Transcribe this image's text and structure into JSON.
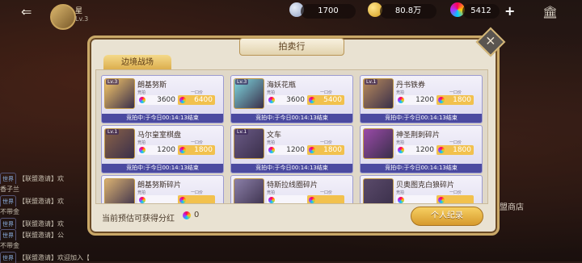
{
  "top": {
    "player_name": "星",
    "player_level": "Lv.3",
    "crystals": "1700",
    "gold": "80.8万",
    "gems": "5412",
    "plus": "+"
  },
  "chat": [
    {
      "tag": "世界",
      "text": "【联盟邀请】欢"
    },
    {
      "tag": "",
      "text": "香子兰"
    },
    {
      "tag": "世界",
      "text": "【联盟邀请】欢"
    },
    {
      "tag": "",
      "text": "不带金"
    },
    {
      "tag": "世界",
      "text": "【联盟邀请】欢"
    },
    {
      "tag": "世界",
      "text": "【联盟邀请】公"
    },
    {
      "tag": "",
      "text": "不带金"
    },
    {
      "tag": "世界",
      "text": "【联盟邀请】欢迎加入【恶的家】"
    }
  ],
  "alliance_shop": "盟商店",
  "modal": {
    "title": "拍卖行",
    "tab": "边境战场",
    "bid_label": "竞拍",
    "buyout_label": "一口价",
    "items": [
      {
        "name": "朗基努斯",
        "lv": "Lv.3",
        "bid": "3600",
        "buyout": "6400",
        "timer": "竞拍中:于今日00:14:13结束",
        "color": "#f7c86a"
      },
      {
        "name": "海妖花瓶",
        "lv": "Lv.3",
        "bid": "3600",
        "buyout": "5400",
        "timer": "竞拍中:于今日00:14:13结束",
        "color": "#7fd8e0"
      },
      {
        "name": "丹书铁券",
        "lv": "Lv.1",
        "bid": "1200",
        "buyout": "1800",
        "timer": "竞拍中:于今日00:14:13结束",
        "color": "#b88a5c"
      },
      {
        "name": "马尔皇室棋盘",
        "lv": "Lv.1",
        "bid": "1200",
        "buyout": "1800",
        "timer": "竞拍中:于今日00:14:13结束",
        "color": "#8a6248"
      },
      {
        "name": "文车",
        "lv": "Lv.1",
        "bid": "1200",
        "buyout": "1800",
        "timer": "竞拍中:于今日00:14:13结束",
        "color": "#6a5a86"
      },
      {
        "name": "神圣荆刺碎片",
        "lv": "",
        "bid": "1200",
        "buyout": "1800",
        "timer": "竞拍中:于今日00:14:13结束",
        "color": "#9a4aa8"
      },
      {
        "name": "朗基努斯碎片",
        "lv": "",
        "bid": "",
        "buyout": "",
        "timer": "",
        "color": "#d9b072"
      },
      {
        "name": "特斯拉线圈碎片",
        "lv": "",
        "bid": "",
        "buyout": "",
        "timer": "",
        "color": "#8b7fa8"
      },
      {
        "name": "贝奥图克白狼碎片",
        "lv": "",
        "bid": "",
        "buyout": "",
        "timer": "",
        "color": "#5a4a6a"
      }
    ],
    "dividend_text": "当前预估可获得分红",
    "dividend_value": "0",
    "records_button": "个人纪录"
  }
}
